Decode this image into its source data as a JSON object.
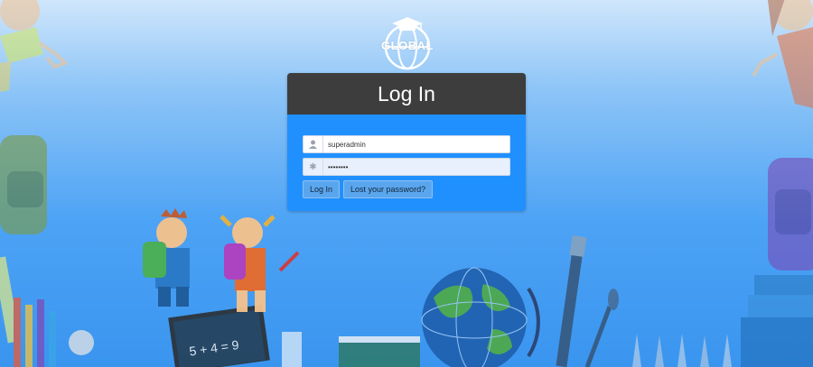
{
  "logo": {
    "text": "GLOBAL"
  },
  "login": {
    "title": "Log In",
    "username": {
      "value": "superadmin",
      "icon": "user-icon"
    },
    "password": {
      "value": "password",
      "icon": "asterisk-icon"
    },
    "login_button": "Log In",
    "lost_password_button": "Lost your password?"
  },
  "colors": {
    "panel_header": "#3d3d3d",
    "panel_body": "#2190ff",
    "button": "#5aa6ee"
  }
}
